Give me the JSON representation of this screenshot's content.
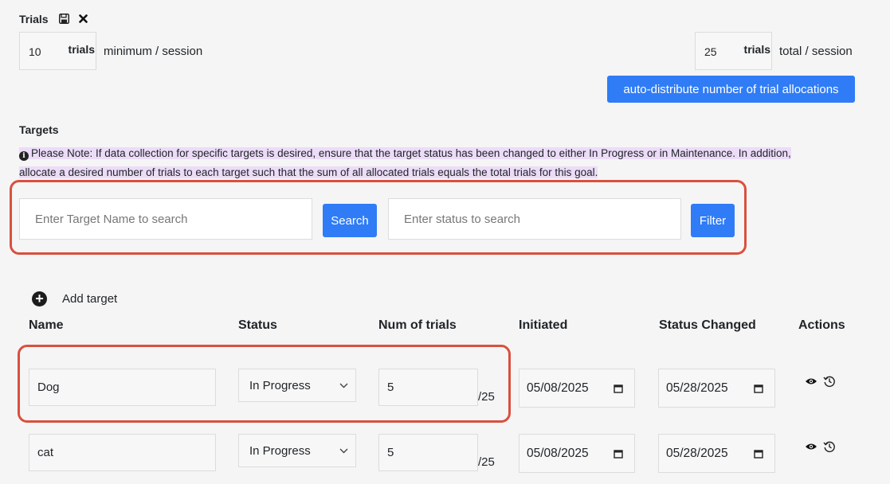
{
  "header": {
    "title": "Trials",
    "save_icon": "save-icon",
    "close_icon": "close-icon"
  },
  "trials": {
    "minimum_value": "10",
    "minimum_unit": "trials",
    "minimum_caption": "minimum / session",
    "total_value": "25",
    "total_unit": "trials",
    "total_caption": "total / session",
    "auto_distribute_label": "auto-distribute number of trial allocations"
  },
  "targets": {
    "section_title": "Targets",
    "note": "Please Note: If data collection for specific targets is desired, ensure that the target status has been changed to either In Progress or in Maintenance. In addition, allocate a desired number of trials to each target such that the sum of all allocated trials equals the total trials for this goal.",
    "search_placeholder": "Enter Target Name to search",
    "search_button": "Search",
    "status_placeholder": "Enter status to search",
    "filter_button": "Filter",
    "add_target_label": "Add target"
  },
  "table": {
    "columns": [
      "Name",
      "Status",
      "Num of trials",
      "Initiated",
      "Status Changed",
      "Actions"
    ],
    "rows": [
      {
        "name": "Dog",
        "status": "In Progress",
        "trials": "5",
        "of_total": "/25",
        "initiated": "05/08/2025",
        "status_changed": "05/28/2025"
      },
      {
        "name": "cat",
        "status": "In Progress",
        "trials": "5",
        "of_total": "/25",
        "initiated": "05/08/2025",
        "status_changed": "05/28/2025"
      }
    ]
  },
  "colors": {
    "primary_button": "#2f7cf6",
    "highlight": "#ecdcf8",
    "annotation_frame": "#d9503f"
  }
}
